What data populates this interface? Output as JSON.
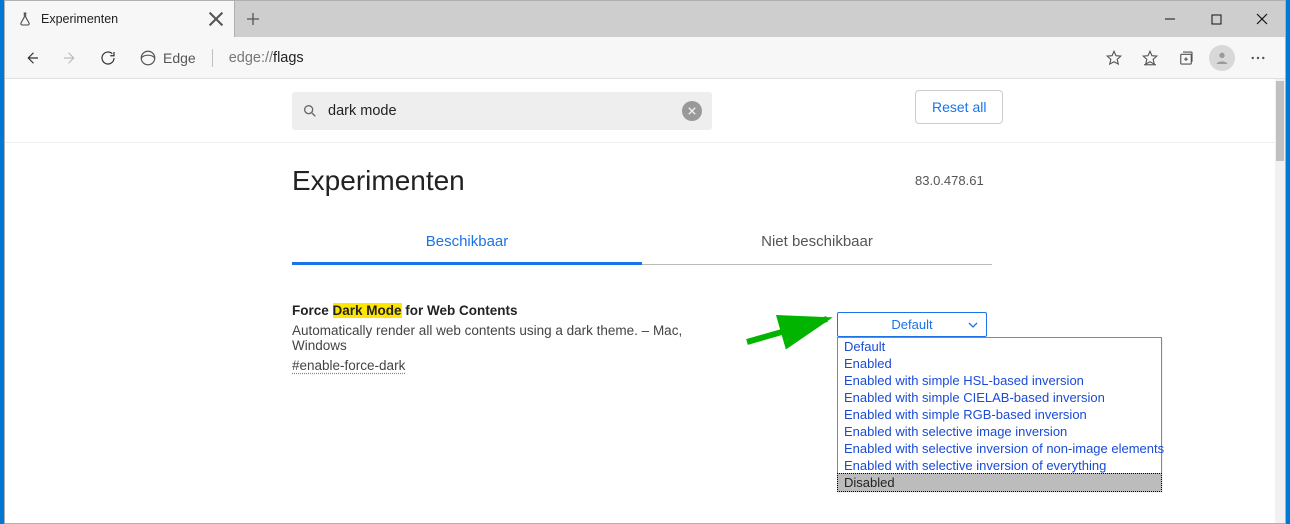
{
  "tab": {
    "title": "Experimenten"
  },
  "address": {
    "brand": "Edge",
    "url_prefix": "edge://",
    "url_bold": "flags"
  },
  "search": {
    "value": "dark mode",
    "reset": "Reset all"
  },
  "heading": "Experimenten",
  "version": "83.0.478.61",
  "tabs": {
    "available": "Beschikbaar",
    "unavailable": "Niet beschikbaar"
  },
  "flag": {
    "title_pre": "Force ",
    "title_hl": "Dark Mode",
    "title_post": " for Web Contents",
    "desc": "Automatically render all web contents using a dark theme. – Mac, Windows",
    "hash": "#enable-force-dark",
    "selected": "Default",
    "options": [
      "Default",
      "Enabled",
      "Enabled with simple HSL-based inversion",
      "Enabled with simple CIELAB-based inversion",
      "Enabled with simple RGB-based inversion",
      "Enabled with selective image inversion",
      "Enabled with selective inversion of non-image elements",
      "Enabled with selective inversion of everything",
      "Disabled"
    ],
    "highlighted_option_index": 8
  }
}
